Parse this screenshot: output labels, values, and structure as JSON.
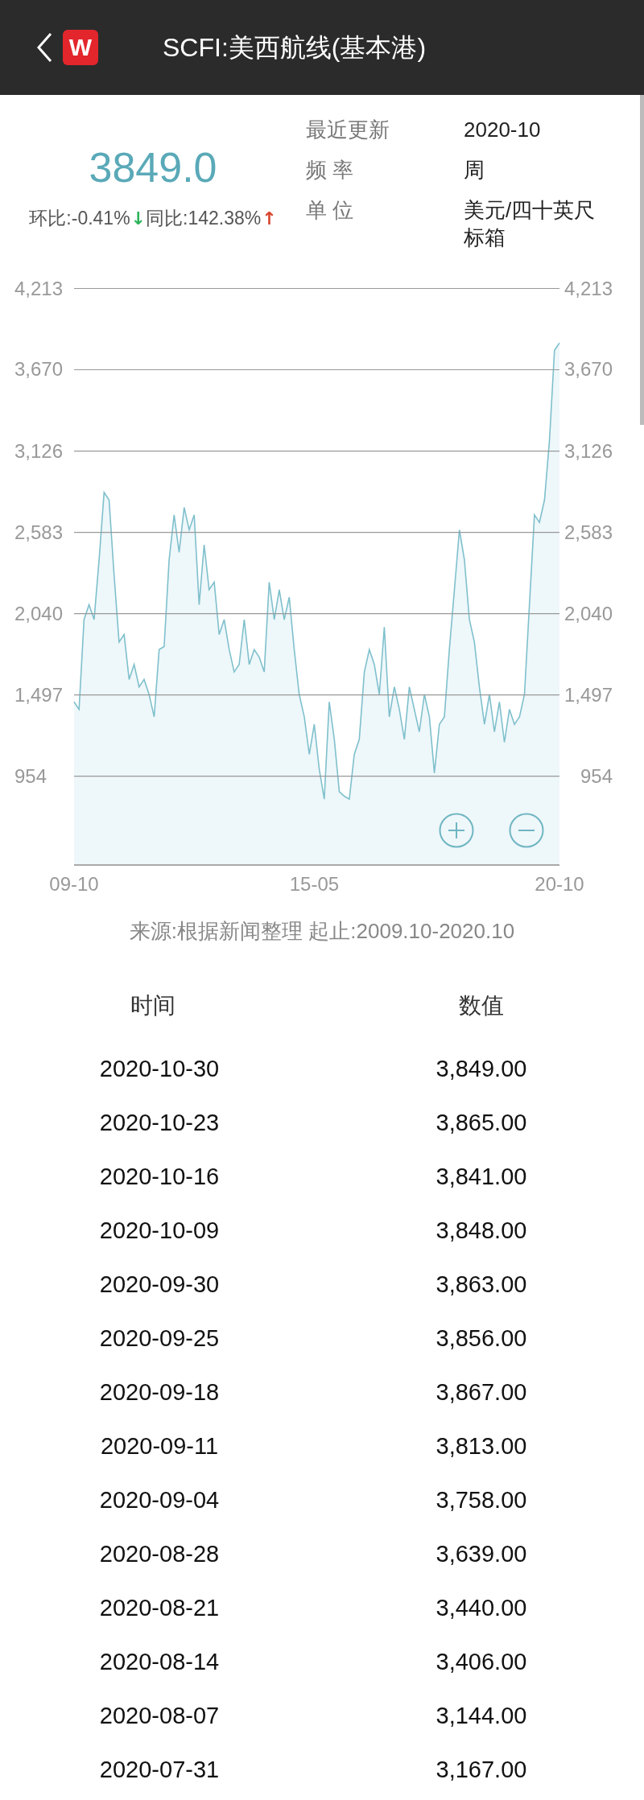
{
  "header": {
    "logo_text": "W",
    "title": "SCFI:美西航线(基本港)"
  },
  "summary": {
    "value": "3849.0",
    "changes": [
      {
        "label": "环比:-0.41%",
        "arrow": "↓",
        "color": "#2db35a"
      },
      {
        "label": "同比:142.38%",
        "arrow": "↑",
        "color": "#d9442e"
      }
    ]
  },
  "info": [
    {
      "label": "最近更新",
      "value": "2020-10"
    },
    {
      "label": "频 率",
      "value": "周"
    },
    {
      "label": "单 位",
      "value": "美元/四十英尺标箱"
    }
  ],
  "chart": {
    "chart_data": {
      "type": "area",
      "grid": true,
      "ylim": [
        360,
        4213
      ],
      "categories": [
        "09-10",
        null,
        null,
        null,
        null,
        null,
        null,
        null,
        null,
        null,
        null,
        null,
        null,
        null,
        null,
        null,
        null,
        null,
        null,
        null,
        null,
        null,
        null,
        null,
        null,
        null,
        null,
        null,
        null,
        null,
        null,
        null,
        null,
        null,
        null,
        null,
        null,
        null,
        null,
        null,
        null,
        null,
        null,
        null,
        null,
        null,
        null,
        null,
        "15-05",
        null,
        null,
        null,
        null,
        null,
        null,
        null,
        null,
        null,
        null,
        null,
        null,
        null,
        null,
        null,
        null,
        null,
        null,
        null,
        null,
        null,
        null,
        null,
        null,
        null,
        null,
        null,
        null,
        null,
        null,
        null,
        null,
        null,
        null,
        null,
        null,
        null,
        null,
        null,
        null,
        null,
        null,
        null,
        null,
        null,
        null,
        null,
        null,
        "20-10"
      ],
      "yticks": [
        {
          "value": 4213,
          "label": "4,213"
        },
        {
          "value": 3670,
          "label": "3,670"
        },
        {
          "value": 3126,
          "label": "3,126"
        },
        {
          "value": 2583,
          "label": "2,583"
        },
        {
          "value": 2040,
          "label": "2,040"
        },
        {
          "value": 1497,
          "label": "1,497"
        },
        {
          "value": 954,
          "label": "954"
        }
      ],
      "series": [
        {
          "color": "#7fc0cc",
          "values": [
            1450,
            1400,
            2000,
            2100,
            2000,
            2400,
            2850,
            2800,
            2300,
            1850,
            1900,
            1600,
            1700,
            1550,
            1600,
            1500,
            1350,
            1800,
            1820,
            2400,
            2700,
            2450,
            2750,
            2600,
            2700,
            2100,
            2500,
            2200,
            2250,
            1900,
            2000,
            1800,
            1650,
            1700,
            2000,
            1700,
            1800,
            1750,
            1650,
            2250,
            2000,
            2200,
            2000,
            2150,
            1800,
            1500,
            1350,
            1100,
            1300,
            1000,
            800,
            1450,
            1200,
            850,
            820,
            800,
            1100,
            1200,
            1650,
            1800,
            1700,
            1500,
            1950,
            1350,
            1550,
            1400,
            1200,
            1550,
            1400,
            1250,
            1500,
            1350,
            975,
            1300,
            1350,
            1800,
            2200,
            2600,
            2400,
            2000,
            1850,
            1550,
            1300,
            1500,
            1250,
            1450,
            1180,
            1400,
            1300,
            1350,
            1500,
            2100,
            2700,
            2650,
            2800,
            3200,
            3800,
            3849
          ]
        }
      ]
    },
    "source": "来源:根据新闻整理 起止:2009.10-2020.10"
  },
  "table": {
    "columns": [
      "时间",
      "数值"
    ],
    "rows": [
      [
        "2020-10-30",
        "3,849.00"
      ],
      [
        "2020-10-23",
        "3,865.00"
      ],
      [
        "2020-10-16",
        "3,841.00"
      ],
      [
        "2020-10-09",
        "3,848.00"
      ],
      [
        "2020-09-30",
        "3,863.00"
      ],
      [
        "2020-09-25",
        "3,856.00"
      ],
      [
        "2020-09-18",
        "3,867.00"
      ],
      [
        "2020-09-11",
        "3,813.00"
      ],
      [
        "2020-09-04",
        "3,758.00"
      ],
      [
        "2020-08-28",
        "3,639.00"
      ],
      [
        "2020-08-21",
        "3,440.00"
      ],
      [
        "2020-08-14",
        "3,406.00"
      ],
      [
        "2020-08-07",
        "3,144.00"
      ],
      [
        "2020-07-31",
        "3,167.00"
      ]
    ]
  }
}
